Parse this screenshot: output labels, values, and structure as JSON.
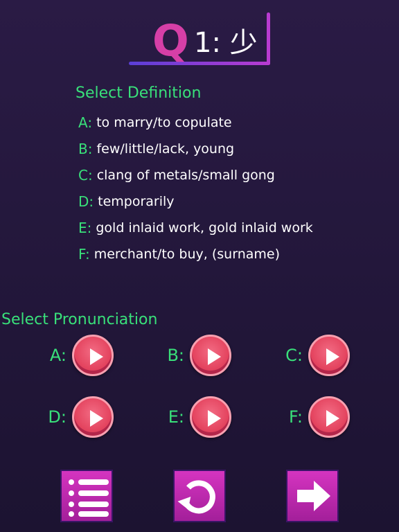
{
  "question": {
    "q_letter": "Q",
    "rest": "1: 少"
  },
  "definition": {
    "heading": "Select Definition",
    "options": [
      {
        "letter": "A:",
        "text": "to marry/to copulate"
      },
      {
        "letter": "B:",
        "text": "few/little/lack, young"
      },
      {
        "letter": "C:",
        "text": "clang of metals/small gong"
      },
      {
        "letter": "D:",
        "text": "temporarily"
      },
      {
        "letter": "E:",
        "text": "gold inlaid work, gold inlaid work"
      },
      {
        "letter": "F:",
        "text": "merchant/to buy, (surname)"
      }
    ]
  },
  "pronunciation": {
    "heading": "Select Pronunciation",
    "options": [
      {
        "letter": "A:"
      },
      {
        "letter": "B:"
      },
      {
        "letter": "C:"
      },
      {
        "letter": "D:"
      },
      {
        "letter": "E:"
      },
      {
        "letter": "F:"
      }
    ]
  },
  "buttons": {
    "menu": "list-icon",
    "replay": "replay-icon",
    "next": "arrow-right-icon"
  },
  "colors": {
    "accent_green": "#39e07a",
    "title_q": "#d63fa7",
    "play_button": "#e4445f",
    "bottom_button": "#c52ab5"
  }
}
